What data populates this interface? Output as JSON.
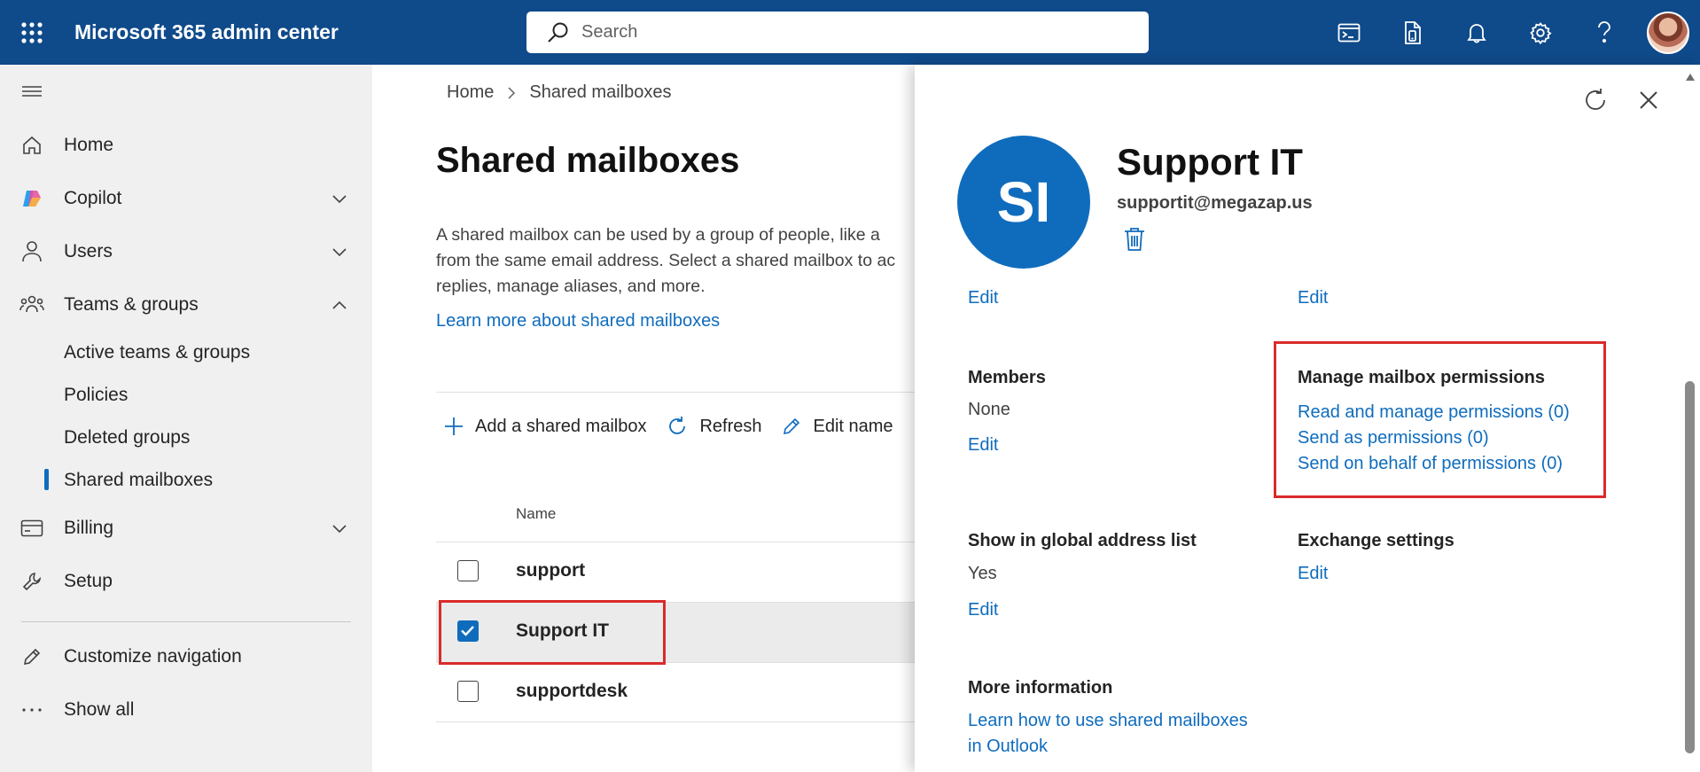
{
  "topbar": {
    "app_title": "Microsoft 365 admin center",
    "search_placeholder": "Search",
    "icons": [
      "terminal-icon",
      "mobile-document-icon",
      "bell-icon",
      "gear-icon",
      "help-icon",
      "avatar"
    ]
  },
  "sidebar": {
    "items": [
      {
        "label": "Home",
        "icon": "home-icon"
      },
      {
        "label": "Copilot",
        "icon": "copilot-icon",
        "expand": "chevron-down"
      },
      {
        "label": "Users",
        "icon": "user-icon",
        "expand": "chevron-down"
      },
      {
        "label": "Teams & groups",
        "icon": "teams-icon",
        "expand": "chevron-up"
      },
      {
        "label": "Billing",
        "icon": "billing-icon",
        "expand": "chevron-down"
      },
      {
        "label": "Setup",
        "icon": "wrench-icon"
      },
      {
        "label": "Customize navigation",
        "icon": "pencil-icon"
      },
      {
        "label": "Show all",
        "icon": "ellipsis-icon"
      }
    ],
    "sub_items": [
      {
        "label": "Active teams & groups"
      },
      {
        "label": "Policies"
      },
      {
        "label": "Deleted groups"
      },
      {
        "label": "Shared mailboxes",
        "selected": true
      }
    ]
  },
  "main": {
    "breadcrumb": {
      "home": "Home",
      "current": "Shared mailboxes"
    },
    "title": "Shared mailboxes",
    "description_lines": [
      "A shared mailbox can be used by a group of people, like a",
      "from the same email address. Select a shared mailbox to ac",
      "replies, manage aliases, and more."
    ],
    "learn_link": "Learn more about shared mailboxes",
    "commands": {
      "add": "Add a shared mailbox",
      "refresh": "Refresh",
      "edit_name": "Edit name"
    },
    "table": {
      "column_name": "Name",
      "rows": [
        {
          "name": "support",
          "checked": false
        },
        {
          "name": "Support IT",
          "checked": true
        },
        {
          "name": "supportdesk",
          "checked": false
        }
      ]
    }
  },
  "panel": {
    "avatar_initials": "SI",
    "name": "Support IT",
    "email": "supportit@megazap.us",
    "edit_label": "Edit",
    "members": {
      "title": "Members",
      "value": "None"
    },
    "permissions": {
      "title": "Manage mailbox permissions",
      "read_manage": "Read and manage permissions (0)",
      "send_as": "Send as permissions (0)",
      "send_on_behalf": "Send on behalf of permissions (0)"
    },
    "gal": {
      "title": "Show in global address list",
      "value": "Yes"
    },
    "exchange": {
      "title": "Exchange settings"
    },
    "more_info": {
      "title": "More information",
      "link_line1": "Learn how to use shared mailboxes",
      "link_line2": "in Outlook"
    }
  },
  "colors": {
    "topbar": "#0f4a8a",
    "accent": "#0f6cbd",
    "highlight": "#d92b2b"
  }
}
